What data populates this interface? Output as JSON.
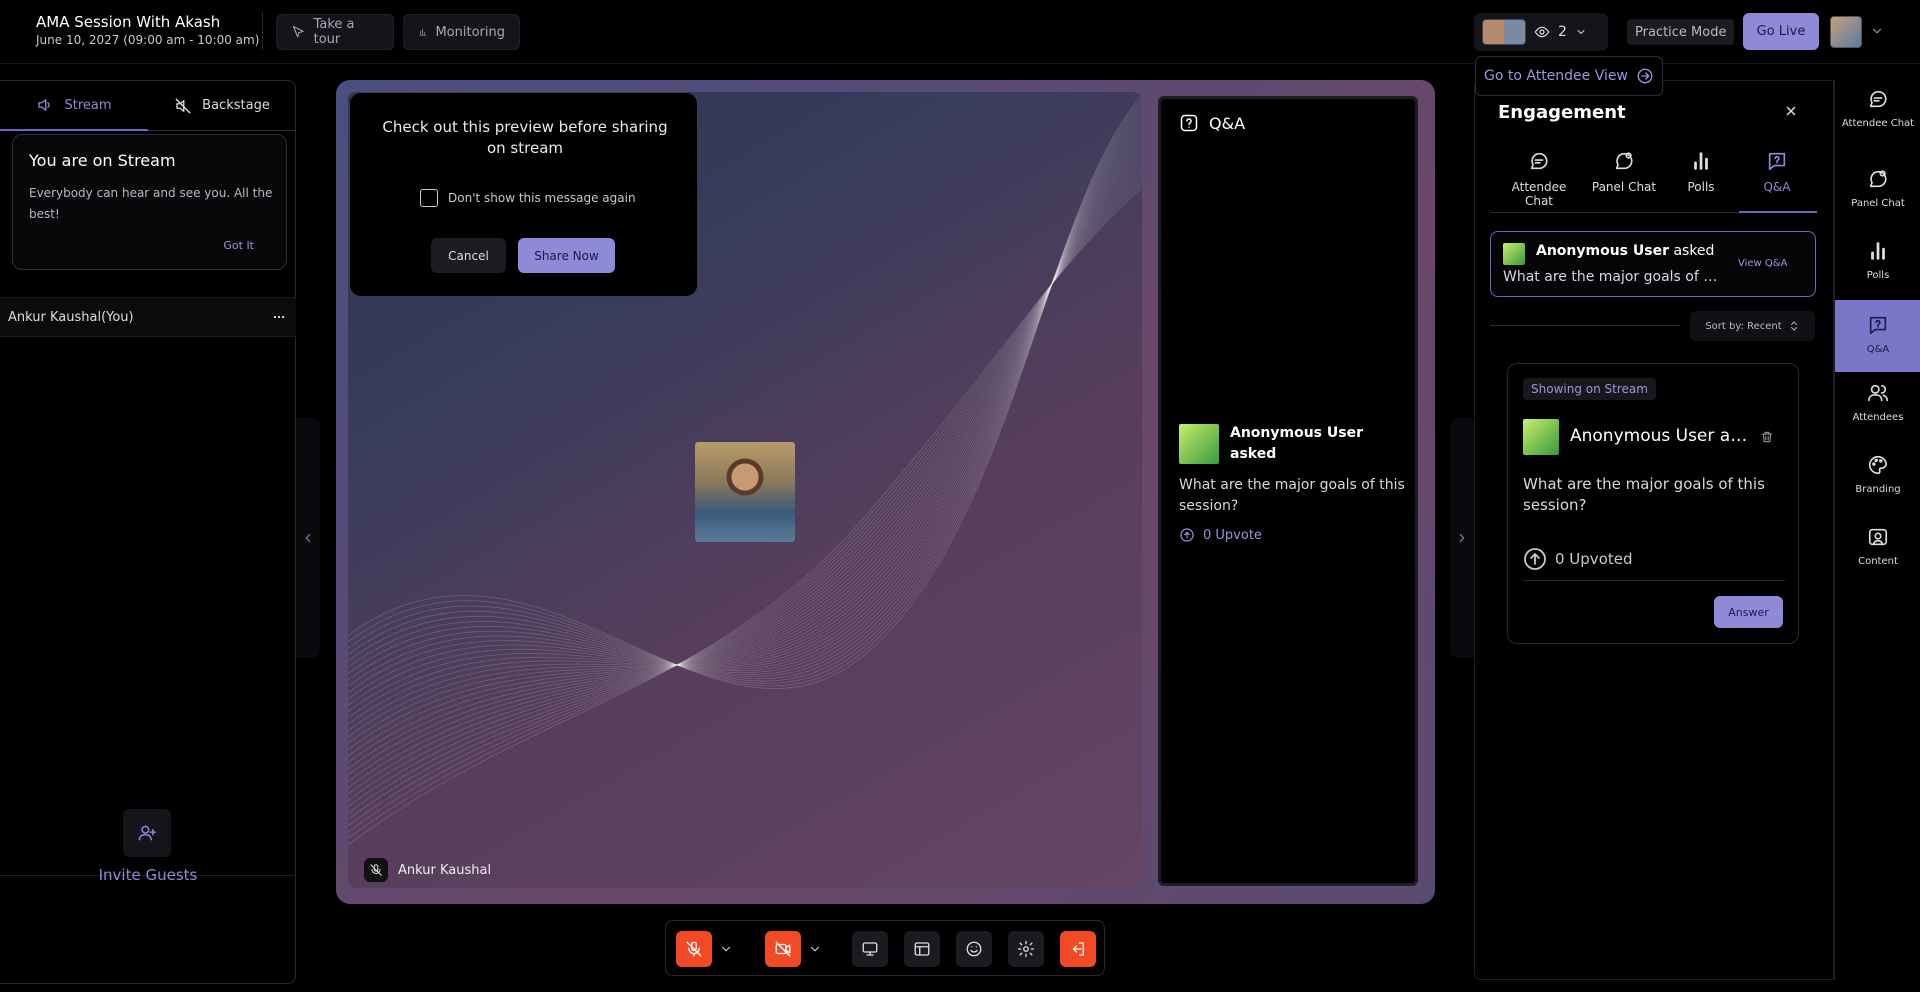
{
  "header": {
    "title": "AMA Session With Akash",
    "datetime": "June 10, 2027 (09:00 am - 10:00 am)",
    "take_tour": "Take a tour",
    "monitoring": "Monitoring",
    "viewer_count": "2",
    "practice_mode": "Practice Mode",
    "go_live": "Go Live"
  },
  "left_panel": {
    "tabs": [
      {
        "label": "Stream"
      },
      {
        "label": "Backstage"
      }
    ],
    "stream_card": {
      "title": "You are on Stream",
      "description": "Everybody can hear and see you. All the best!",
      "action": "Got It"
    },
    "user_row": {
      "name": "Ankur Kaushal(You)"
    },
    "invite_label": "Invite Guests"
  },
  "stage": {
    "preview_dialog": {
      "message": "Check out this preview before sharing on stream",
      "checkbox_label": "Don't show this message again",
      "cancel": "Cancel",
      "share": "Share Now"
    },
    "speaker_name": "Ankur Kaushal",
    "qa_panel": {
      "title": "Q&A",
      "asker": "Anonymous User asked",
      "question": "What are the major goals of this session?",
      "upvote": "0 Upvote"
    }
  },
  "engagement": {
    "go_to_attendee_view": "Go to Attendee View",
    "title": "Engagement",
    "tabs": [
      {
        "label": "Attendee Chat"
      },
      {
        "label": "Panel Chat"
      },
      {
        "label": "Polls"
      },
      {
        "label": "Q&A"
      }
    ],
    "summary": {
      "asker_name": "Anonymous User",
      "asked": "asked",
      "question": "What are the major goals of this session?",
      "view": "View Q&A"
    },
    "sort": "Sort by: Recent",
    "card": {
      "badge": "Showing on Stream",
      "asker": "Anonymous User asked",
      "question": "What are the major goals of this session?",
      "upvoted": "0 Upvoted",
      "answer": "Answer"
    }
  },
  "right_sidebar": {
    "items": [
      {
        "label": "Attendee Chat"
      },
      {
        "label": "Panel Chat"
      },
      {
        "label": "Polls"
      },
      {
        "label": "Q&A"
      },
      {
        "label": "Attendees"
      },
      {
        "label": "Branding"
      },
      {
        "label": "Content"
      }
    ]
  },
  "colors": {
    "accent": "#8e8ad8",
    "danger": "#f24a24",
    "background": "#000000"
  }
}
